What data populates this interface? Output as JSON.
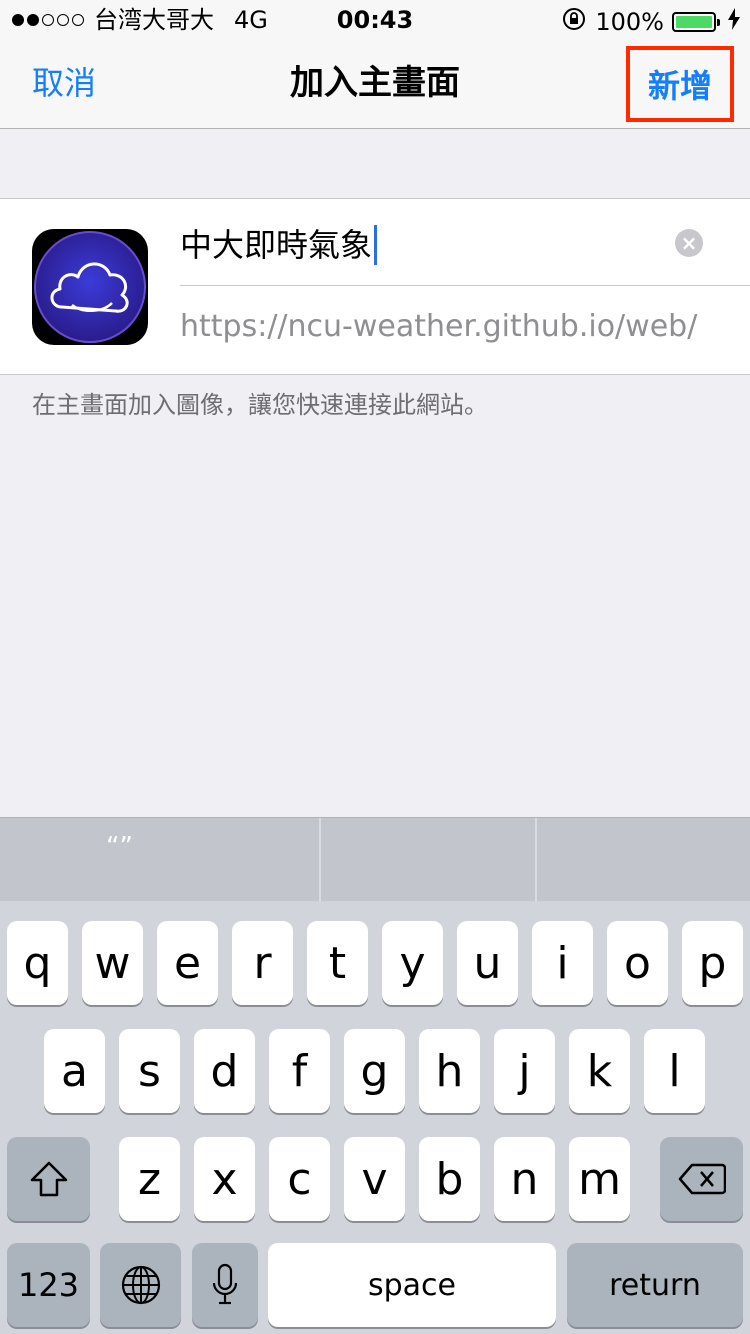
{
  "status_bar": {
    "carrier": "台湾大哥大",
    "network": "4G",
    "time": "00:43",
    "battery": "100%",
    "battery_color": "#4cd964"
  },
  "nav": {
    "cancel_label": "取消",
    "title": "加入主畫面",
    "add_label": "新增",
    "accent": "#157efb",
    "highlight": "#ff2a00"
  },
  "form": {
    "icon": "cloud-icon",
    "name_value": "中大即時氣象",
    "url_value": "https://ncu-weather.github.io/web/",
    "hint": "在主畫面加入圖像，讓您快速連接此網站。"
  },
  "predictive": [
    "“”",
    "",
    ""
  ],
  "keyboard": {
    "row1": [
      "q",
      "w",
      "e",
      "r",
      "t",
      "y",
      "u",
      "i",
      "o",
      "p"
    ],
    "row2": [
      "a",
      "s",
      "d",
      "f",
      "g",
      "h",
      "j",
      "k",
      "l"
    ],
    "row3": [
      "z",
      "x",
      "c",
      "v",
      "b",
      "n",
      "m"
    ],
    "numbers_label": "123",
    "space_label": "space",
    "return_label": "return"
  }
}
